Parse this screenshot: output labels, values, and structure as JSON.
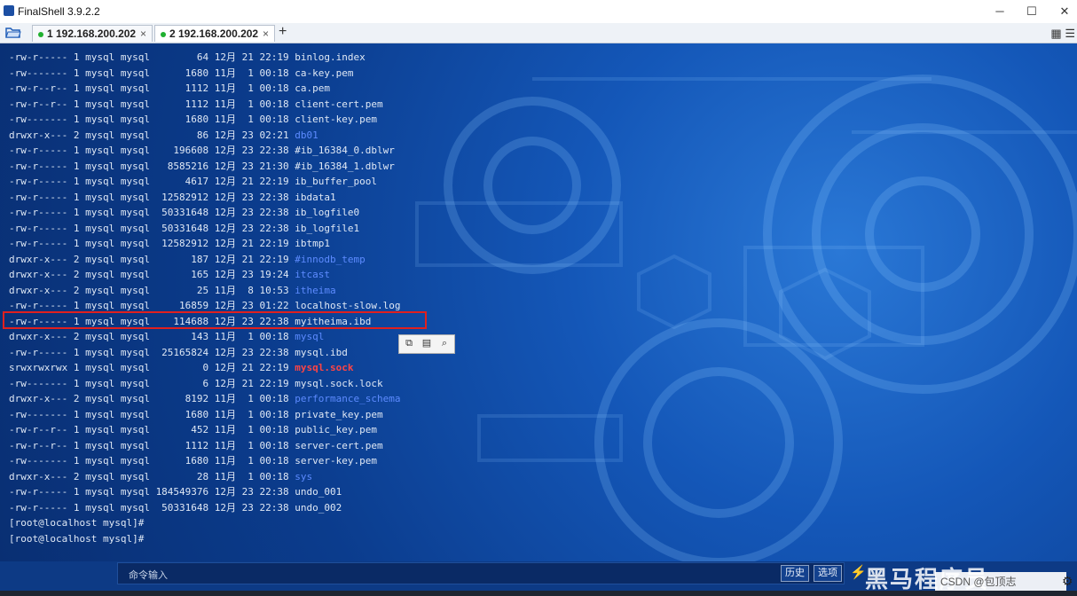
{
  "app": {
    "title": "FinalShell 3.9.2.2",
    "minimize": "─",
    "maximize": "☐",
    "close": "✕"
  },
  "tabs": [
    {
      "label": "1 192.168.200.202",
      "close": "×"
    },
    {
      "label": "2 192.168.200.202",
      "close": "×"
    }
  ],
  "add_tab": "+",
  "listing": [
    {
      "perm": "-rw-r-----",
      "links": "1",
      "owner": "mysql",
      "group": "mysql",
      "size": "64",
      "month": "12月",
      "day": "21",
      "time": "22:19",
      "name": "binlog.index",
      "kind": "file"
    },
    {
      "perm": "-rw-------",
      "links": "1",
      "owner": "mysql",
      "group": "mysql",
      "size": "1680",
      "month": "11月",
      "day": "1",
      "time": "00:18",
      "name": "ca-key.pem",
      "kind": "file"
    },
    {
      "perm": "-rw-r--r--",
      "links": "1",
      "owner": "mysql",
      "group": "mysql",
      "size": "1112",
      "month": "11月",
      "day": "1",
      "time": "00:18",
      "name": "ca.pem",
      "kind": "file"
    },
    {
      "perm": "-rw-r--r--",
      "links": "1",
      "owner": "mysql",
      "group": "mysql",
      "size": "1112",
      "month": "11月",
      "day": "1",
      "time": "00:18",
      "name": "client-cert.pem",
      "kind": "file"
    },
    {
      "perm": "-rw-------",
      "links": "1",
      "owner": "mysql",
      "group": "mysql",
      "size": "1680",
      "month": "11月",
      "day": "1",
      "time": "00:18",
      "name": "client-key.pem",
      "kind": "file"
    },
    {
      "perm": "drwxr-x---",
      "links": "2",
      "owner": "mysql",
      "group": "mysql",
      "size": "86",
      "month": "12月",
      "day": "23",
      "time": "02:21",
      "name": "db01",
      "kind": "dir"
    },
    {
      "perm": "-rw-r-----",
      "links": "1",
      "owner": "mysql",
      "group": "mysql",
      "size": "196608",
      "month": "12月",
      "day": "23",
      "time": "22:38",
      "name": "#ib_16384_0.dblwr",
      "kind": "file"
    },
    {
      "perm": "-rw-r-----",
      "links": "1",
      "owner": "mysql",
      "group": "mysql",
      "size": "8585216",
      "month": "12月",
      "day": "23",
      "time": "21:30",
      "name": "#ib_16384_1.dblwr",
      "kind": "file"
    },
    {
      "perm": "-rw-r-----",
      "links": "1",
      "owner": "mysql",
      "group": "mysql",
      "size": "4617",
      "month": "12月",
      "day": "21",
      "time": "22:19",
      "name": "ib_buffer_pool",
      "kind": "file"
    },
    {
      "perm": "-rw-r-----",
      "links": "1",
      "owner": "mysql",
      "group": "mysql",
      "size": "12582912",
      "month": "12月",
      "day": "23",
      "time": "22:38",
      "name": "ibdata1",
      "kind": "file"
    },
    {
      "perm": "-rw-r-----",
      "links": "1",
      "owner": "mysql",
      "group": "mysql",
      "size": "50331648",
      "month": "12月",
      "day": "23",
      "time": "22:38",
      "name": "ib_logfile0",
      "kind": "file"
    },
    {
      "perm": "-rw-r-----",
      "links": "1",
      "owner": "mysql",
      "group": "mysql",
      "size": "50331648",
      "month": "12月",
      "day": "23",
      "time": "22:38",
      "name": "ib_logfile1",
      "kind": "file"
    },
    {
      "perm": "-rw-r-----",
      "links": "1",
      "owner": "mysql",
      "group": "mysql",
      "size": "12582912",
      "month": "12月",
      "day": "21",
      "time": "22:19",
      "name": "ibtmp1",
      "kind": "file"
    },
    {
      "perm": "drwxr-x---",
      "links": "2",
      "owner": "mysql",
      "group": "mysql",
      "size": "187",
      "month": "12月",
      "day": "21",
      "time": "22:19",
      "name": "#innodb_temp",
      "kind": "dir"
    },
    {
      "perm": "drwxr-x---",
      "links": "2",
      "owner": "mysql",
      "group": "mysql",
      "size": "165",
      "month": "12月",
      "day": "23",
      "time": "19:24",
      "name": "itcast",
      "kind": "dir"
    },
    {
      "perm": "drwxr-x---",
      "links": "2",
      "owner": "mysql",
      "group": "mysql",
      "size": "25",
      "month": "11月",
      "day": "8",
      "time": "10:53",
      "name": "itheima",
      "kind": "dir"
    },
    {
      "perm": "-rw-r-----",
      "links": "1",
      "owner": "mysql",
      "group": "mysql",
      "size": "16859",
      "month": "12月",
      "day": "23",
      "time": "01:22",
      "name": "localhost-slow.log",
      "kind": "file"
    },
    {
      "perm": "-rw-r-----",
      "links": "1",
      "owner": "mysql",
      "group": "mysql",
      "size": "114688",
      "month": "12月",
      "day": "23",
      "time": "22:38",
      "name": "myitheima.ibd",
      "kind": "file"
    },
    {
      "perm": "drwxr-x---",
      "links": "2",
      "owner": "mysql",
      "group": "mysql",
      "size": "143",
      "month": "11月",
      "day": "1",
      "time": "00:18",
      "name": "mysql",
      "kind": "dir"
    },
    {
      "perm": "-rw-r-----",
      "links": "1",
      "owner": "mysql",
      "group": "mysql",
      "size": "25165824",
      "month": "12月",
      "day": "23",
      "time": "22:38",
      "name": "mysql.ibd",
      "kind": "file"
    },
    {
      "perm": "srwxrwxrwx",
      "links": "1",
      "owner": "mysql",
      "group": "mysql",
      "size": "0",
      "month": "12月",
      "day": "21",
      "time": "22:19",
      "name": "mysql.sock",
      "kind": "sock"
    },
    {
      "perm": "-rw-------",
      "links": "1",
      "owner": "mysql",
      "group": "mysql",
      "size": "6",
      "month": "12月",
      "day": "21",
      "time": "22:19",
      "name": "mysql.sock.lock",
      "kind": "file"
    },
    {
      "perm": "drwxr-x---",
      "links": "2",
      "owner": "mysql",
      "group": "mysql",
      "size": "8192",
      "month": "11月",
      "day": "1",
      "time": "00:18",
      "name": "performance_schema",
      "kind": "dir"
    },
    {
      "perm": "-rw-------",
      "links": "1",
      "owner": "mysql",
      "group": "mysql",
      "size": "1680",
      "month": "11月",
      "day": "1",
      "time": "00:18",
      "name": "private_key.pem",
      "kind": "file"
    },
    {
      "perm": "-rw-r--r--",
      "links": "1",
      "owner": "mysql",
      "group": "mysql",
      "size": "452",
      "month": "11月",
      "day": "1",
      "time": "00:18",
      "name": "public_key.pem",
      "kind": "file"
    },
    {
      "perm": "-rw-r--r--",
      "links": "1",
      "owner": "mysql",
      "group": "mysql",
      "size": "1112",
      "month": "11月",
      "day": "1",
      "time": "00:18",
      "name": "server-cert.pem",
      "kind": "file"
    },
    {
      "perm": "-rw-------",
      "links": "1",
      "owner": "mysql",
      "group": "mysql",
      "size": "1680",
      "month": "11月",
      "day": "1",
      "time": "00:18",
      "name": "server-key.pem",
      "kind": "file"
    },
    {
      "perm": "drwxr-x---",
      "links": "2",
      "owner": "mysql",
      "group": "mysql",
      "size": "28",
      "month": "11月",
      "day": "1",
      "time": "00:18",
      "name": "sys",
      "kind": "dir"
    },
    {
      "perm": "-rw-r-----",
      "links": "1",
      "owner": "mysql",
      "group": "mysql",
      "size": "184549376",
      "month": "12月",
      "day": "23",
      "time": "22:38",
      "name": "undo_001",
      "kind": "file"
    },
    {
      "perm": "-rw-r-----",
      "links": "1",
      "owner": "mysql",
      "group": "mysql",
      "size": "50331648",
      "month": "12月",
      "day": "23",
      "time": "22:38",
      "name": "undo_002",
      "kind": "file"
    }
  ],
  "prompts": [
    "[root@localhost mysql]#",
    "[root@localhost mysql]#"
  ],
  "colors": {
    "dir": "#5d8bff",
    "socket": "#ff4444",
    "highlight_box": "#e0201f",
    "file": "#dfe8f5"
  },
  "command_bar": {
    "placeholder": "命令输入",
    "history": "历史",
    "options": "选项"
  },
  "watermark": "黑马程序员",
  "csdn": "CSDN @包顶志"
}
